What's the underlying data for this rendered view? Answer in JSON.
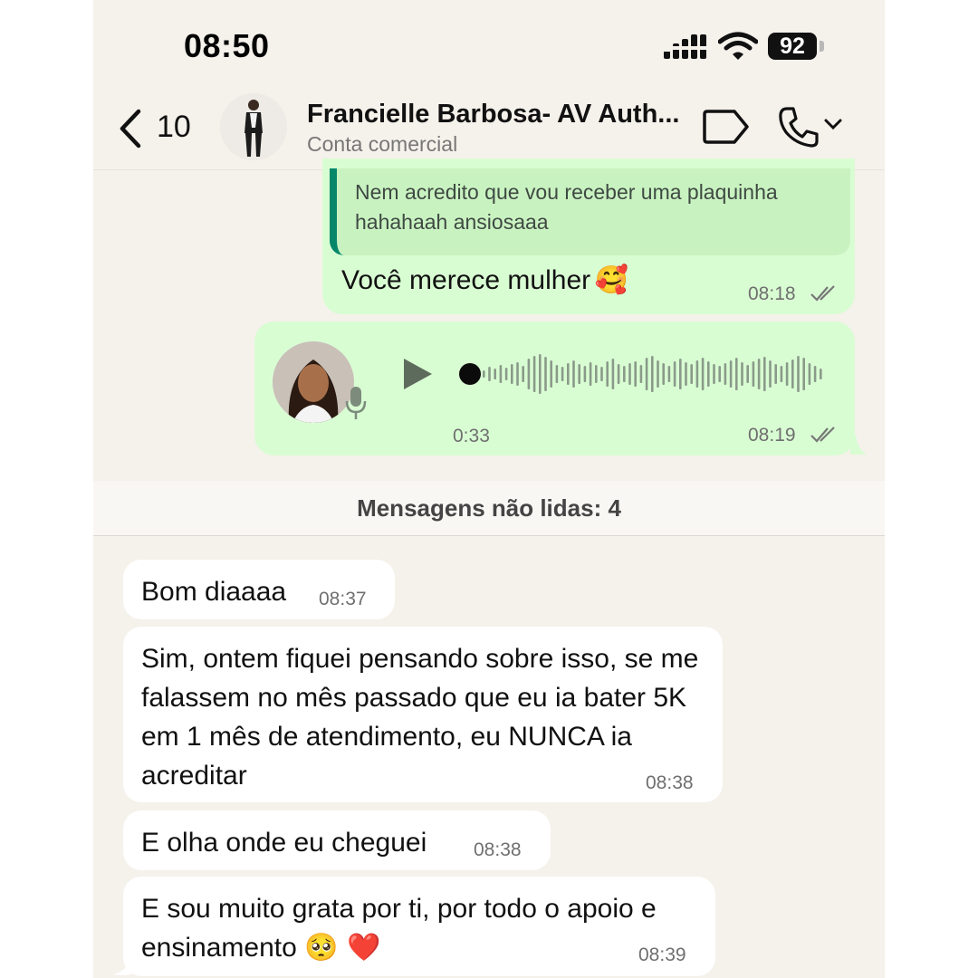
{
  "status_bar": {
    "time": "08:50",
    "battery": "92"
  },
  "header": {
    "back_count": "10",
    "contact_name": "Francielle Barbosa- AV Auth...",
    "contact_subtitle": "Conta comercial"
  },
  "messages_out": {
    "quoted_text": "Nem acredito que vou receber uma plaquinha hahahaah ansiosaaa",
    "reply_text": "Você merece mulher",
    "reply_emoji": "🥰",
    "reply_time": "08:18",
    "voice_duration": "0:33",
    "voice_time": "08:19"
  },
  "unread_banner": "Mensagens não lidas: 4",
  "messages_in": [
    {
      "text": "Bom diaaaa",
      "time": "08:37"
    },
    {
      "text": "Sim, ontem fiquei pensando sobre isso, se me falassem no mês passado que eu ia bater 5K em 1 mês de atendimento, eu NUNCA ia acreditar",
      "time": "08:38"
    },
    {
      "text": "E olha onde eu cheguei",
      "time": "08:38"
    },
    {
      "text": "E sou muito grata por ti, por todo o apoio e ensinamento",
      "emoji": "🥺 ❤️",
      "time": "08:39"
    }
  ],
  "colors": {
    "outgoing": "#d9fdd3",
    "incoming": "#ffffff",
    "background": "#f5f1eb",
    "quote_bar": "#06876a"
  },
  "icons": [
    "back-chevron-icon",
    "label-tag-icon",
    "phone-call-icon",
    "chevron-down-icon",
    "play-icon",
    "microphone-icon",
    "double-check-icon",
    "signal-icon",
    "wifi-icon"
  ]
}
